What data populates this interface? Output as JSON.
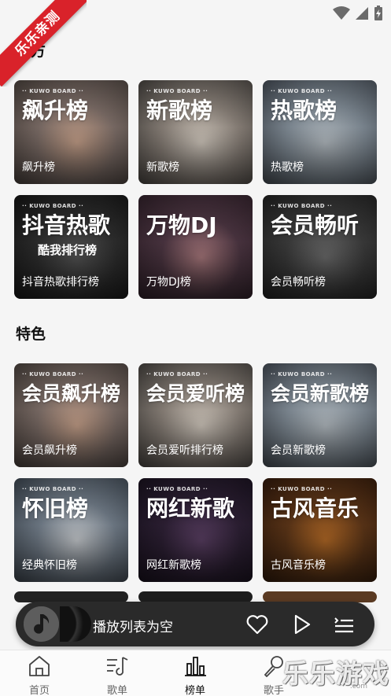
{
  "ribbon": {
    "text": "乐乐亲测"
  },
  "sections": {
    "official_title": "官方",
    "featured_title": "特色"
  },
  "official": [
    {
      "board": "·· KUWO BOARD ··",
      "big": "飙升榜",
      "cap": "飙升榜",
      "colors": [
        "#7b6c66",
        "#c9a38c",
        "#3f3834"
      ]
    },
    {
      "board": "·· KUWO BOARD ··",
      "big": "新歌榜",
      "cap": "新歌榜",
      "colors": [
        "#8a8179",
        "#d6cdc2",
        "#3b3835"
      ]
    },
    {
      "board": "·· KUWO BOARD ··",
      "big": "热歌榜",
      "cap": "热歌榜",
      "colors": [
        "#7f8a94",
        "#b8c0c6",
        "#3a4048"
      ]
    },
    {
      "board": "·· KUWO BOARD ··",
      "big": "抖音热歌",
      "sub": "酷我排行榜",
      "cap": "抖音热歌排行榜",
      "colors": [
        "#2d2d2d",
        "#545454",
        "#111111"
      ]
    },
    {
      "board": "",
      "big": "万物DJ",
      "cap": "万物DJ榜",
      "colors": [
        "#4a3440",
        "#a8787c",
        "#2a1c24"
      ]
    },
    {
      "board": "·· KUWO BOARD ··",
      "big": "会员畅听",
      "cap": "会员畅听榜",
      "colors": [
        "#3a3a3a",
        "#6b6b6b",
        "#1c1c1c"
      ]
    }
  ],
  "featured": [
    {
      "board": "·· KUWO BOARD ··",
      "big": "会员飙升榜",
      "cap": "会员飙升榜",
      "colors": [
        "#7b6c66",
        "#c9a38c",
        "#3f3834"
      ]
    },
    {
      "board": "·· KUWO BOARD ··",
      "big": "会员爱听榜",
      "cap": "会员爱听排行榜",
      "colors": [
        "#8a8179",
        "#d6cdc2",
        "#3b3835"
      ]
    },
    {
      "board": "·· KUWO BOARD ··",
      "big": "会员新歌榜",
      "cap": "会员新歌榜",
      "colors": [
        "#7f8a94",
        "#b8c0c6",
        "#3a4048"
      ]
    },
    {
      "board": "·· KUWO BOARD ··",
      "big": "怀旧榜",
      "cap": "经典怀旧榜",
      "colors": [
        "#6f7a86",
        "#c8ccd0",
        "#333b44"
      ]
    },
    {
      "board": "·· KUWO BOARD ··",
      "big": "网红新歌",
      "cap": "网红新歌榜",
      "colors": [
        "#2c1f33",
        "#5a3f63",
        "#150f1a"
      ]
    },
    {
      "board": "·· KUWO BOARD ··",
      "big": "古风音乐",
      "cap": "古风音乐榜",
      "colors": [
        "#5a3417",
        "#b46a26",
        "#2a1509"
      ]
    }
  ],
  "player": {
    "text": "播放列表为空"
  },
  "tabs": [
    {
      "label": "首页",
      "icon": "home-icon",
      "active": false
    },
    {
      "label": "歌单",
      "icon": "playlist-icon",
      "active": false
    },
    {
      "label": "榜单",
      "icon": "chart-icon",
      "active": true
    },
    {
      "label": "歌手",
      "icon": "singer-icon",
      "active": false
    }
  ],
  "watermark": {
    "text": "乐乐游戏",
    "sub": ".com"
  }
}
